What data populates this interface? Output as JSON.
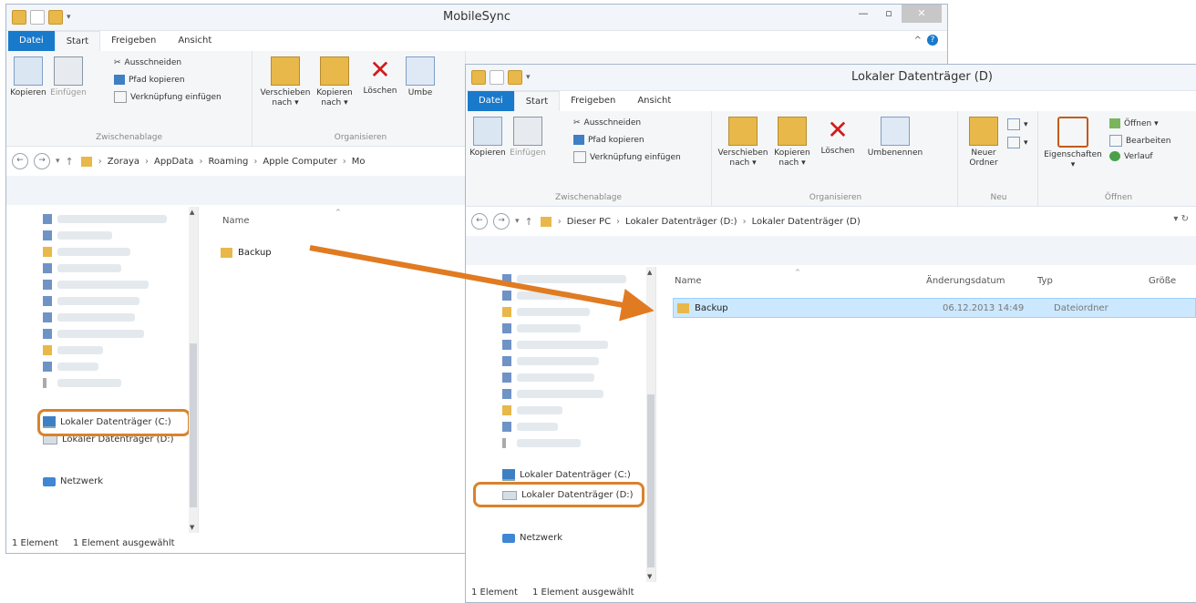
{
  "colors": {
    "accent": "#1979ca",
    "folder": "#e8b84a",
    "highlight": "#d9822b",
    "selection": "#cce8ff"
  },
  "window1": {
    "title": "MobileSync",
    "tabs": {
      "file": "Datei",
      "start": "Start",
      "share": "Freigeben",
      "view": "Ansicht"
    },
    "ribbon": {
      "copy": "Kopieren",
      "paste": "Einfügen",
      "cut": "Ausschneiden",
      "copy_path": "Pfad kopieren",
      "paste_shortcut": "Verknüpfung einfügen",
      "group_clipboard": "Zwischenablage",
      "move_to_1": "Verschieben",
      "move_to_2": "nach ▾",
      "copy_to_1": "Kopieren",
      "copy_to_2": "nach ▾",
      "delete": "Löschen",
      "rename": "Umbe",
      "group_organize": "Organisieren"
    },
    "address": [
      "Zoraya",
      "AppData",
      "Roaming",
      "Apple Computer",
      "Mo"
    ],
    "nav": {
      "drive_c": "Lokaler Datenträger (C:)",
      "drive_d": "Lokaler Datenträger (D:)",
      "network": "Netzwerk"
    },
    "columns": {
      "name": "Name"
    },
    "files": [
      {
        "name": "Backup"
      }
    ],
    "status": {
      "count": "1 Element",
      "selected": "1 Element ausgewählt"
    }
  },
  "window2": {
    "title": "Lokaler Datenträger (D)",
    "tabs": {
      "file": "Datei",
      "start": "Start",
      "share": "Freigeben",
      "view": "Ansicht"
    },
    "ribbon": {
      "copy": "Kopieren",
      "paste": "Einfügen",
      "cut": "Ausschneiden",
      "copy_path": "Pfad kopieren",
      "paste_shortcut": "Verknüpfung einfügen",
      "group_clipboard": "Zwischenablage",
      "move_to_1": "Verschieben",
      "move_to_2": "nach ▾",
      "copy_to_1": "Kopieren",
      "copy_to_2": "nach ▾",
      "delete": "Löschen",
      "rename": "Umbenennen",
      "group_organize": "Organisieren",
      "new_folder_1": "Neuer",
      "new_folder_2": "Ordner",
      "group_new": "Neu",
      "properties": "Eigenschaften",
      "open": "Öffnen ▾",
      "edit": "Bearbeiten",
      "history": "Verlauf",
      "group_open": "Öffnen"
    },
    "address": [
      "Dieser PC",
      "Lokaler Datenträger (D:)",
      "Lokaler Datenträger (D)"
    ],
    "nav": {
      "drive_c": "Lokaler Datenträger (C:)",
      "drive_d": "Lokaler Datenträger (D:)",
      "network": "Netzwerk"
    },
    "columns": {
      "name": "Name",
      "date": "Änderungsdatum",
      "type": "Typ",
      "size": "Größe"
    },
    "files": [
      {
        "name": "Backup",
        "date": "06.12.2013 14:49",
        "type": "Dateiordner"
      }
    ],
    "status": {
      "count": "1 Element",
      "selected": "1 Element ausgewählt"
    }
  }
}
